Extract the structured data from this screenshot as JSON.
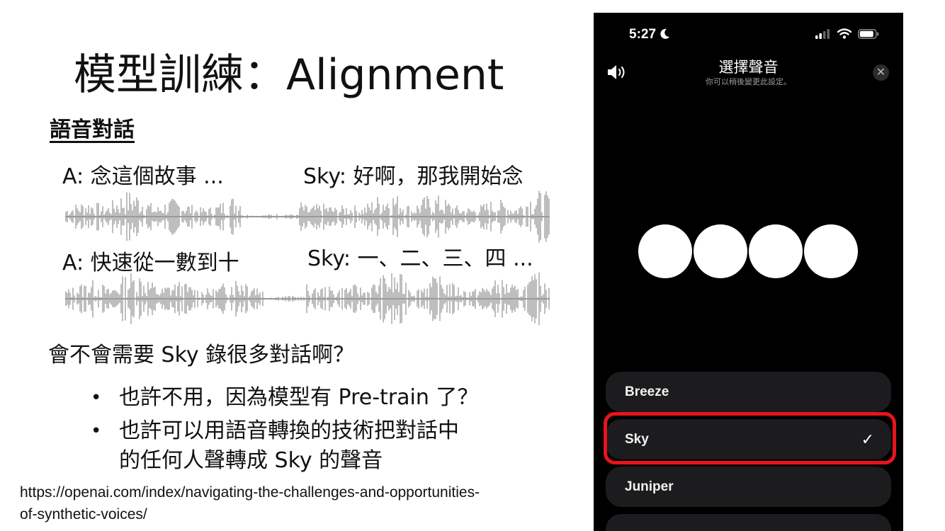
{
  "slide": {
    "title": "模型訓練：Alignment",
    "section_heading": "語音對話",
    "dialogues": [
      {
        "speaker_a": "A: 念這個故事 ...",
        "speaker_sky": "Sky: 好啊，那我開始念"
      },
      {
        "speaker_a": "A: 快速從一數到十",
        "speaker_sky": "Sky: 一、二、三、四 ..."
      }
    ],
    "question": "會不會需要 Sky 錄很多對話啊？",
    "bullets": [
      {
        "marker": "•",
        "text": "也許不用，因為模型有 Pre-train 了？"
      },
      {
        "marker": "•",
        "line1": "也許可以用語音轉換的技術把對話中",
        "line2": "的任何人聲轉成 Sky 的聲音"
      }
    ],
    "source_url_line1": "https://openai.com/index/navigating-the-challenges-and-opportunities-",
    "source_url_line2": "of-synthetic-voices/",
    "waveform_color": "#9a9a9a"
  },
  "phone": {
    "status": {
      "time": "5:27",
      "focus_icon": "moon-icon",
      "signal_icon": "cellular-signal-icon",
      "wifi_icon": "wifi-icon",
      "battery_icon": "battery-icon"
    },
    "header": {
      "title": "選擇聲音",
      "subtitle": "你可以稍後變更此設定。",
      "speaker_icon": "speaker-icon",
      "close_icon": "close-icon"
    },
    "voices": [
      {
        "name": "Breeze",
        "selected": false
      },
      {
        "name": "Sky",
        "selected": true,
        "check": "✓"
      },
      {
        "name": "Juniper",
        "selected": false
      }
    ],
    "highlight_color": "#e8141b",
    "background": "#000000",
    "option_background": "#1c1c1e"
  }
}
